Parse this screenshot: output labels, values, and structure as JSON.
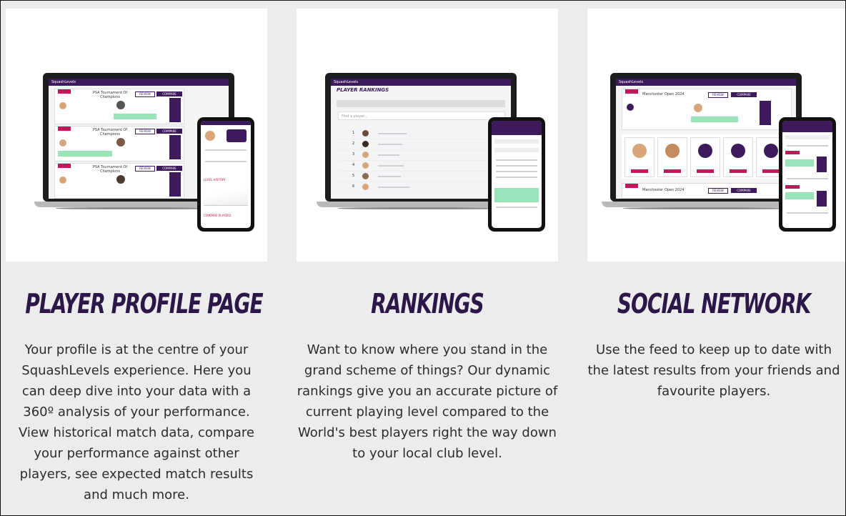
{
  "features": [
    {
      "title": "PLAYER PROFILE PAGE",
      "description": "Your profile is at the centre of your SquashLevels experience. Here you can deep dive into your data with a 360º analysis of your performance. View historical match data, compare your performance against other players, see expected match results and much more.",
      "screenshot": {
        "logo": "SquashLevels",
        "cards": [
          "PSA Tournament Of Champions",
          "PSA Tournament Of Champions",
          "PSA Tournament Of Champions"
        ],
        "buttons": [
          "REVIEW",
          "COMPARE"
        ],
        "phone_sections": [
          "LEVEL HISTORY",
          "COMPARE PLAYERS"
        ]
      }
    },
    {
      "title": "RANKINGS",
      "description": "Want to know where you stand in the grand scheme of things? Our dynamic rankings give you an accurate picture of current playing level compared to the World's best players right the way down to your local club level.",
      "screenshot": {
        "logo": "SquashLevels",
        "page_title": "PLAYER RANKINGS",
        "search_placeholder": "Find a player...",
        "rank_numbers": [
          "1",
          "2",
          "3",
          "4",
          "5",
          "6"
        ]
      }
    },
    {
      "title": "SOCIAL NETWORK",
      "description": "Use the feed to keep up to date with the latest results from your friends and favourite players.",
      "screenshot": {
        "logo": "SquashLevels",
        "event_titles": [
          "Manchester Open 2024",
          "Manchester Open 2024"
        ],
        "buttons": [
          "REVIEW",
          "COMPARE"
        ]
      }
    }
  ],
  "colors": {
    "heading": "#2b1748",
    "brand_purple": "#3d1a5b",
    "brand_pink": "#c2185b",
    "accent_green": "#9be3b8",
    "panel_bg": "#ececec"
  }
}
